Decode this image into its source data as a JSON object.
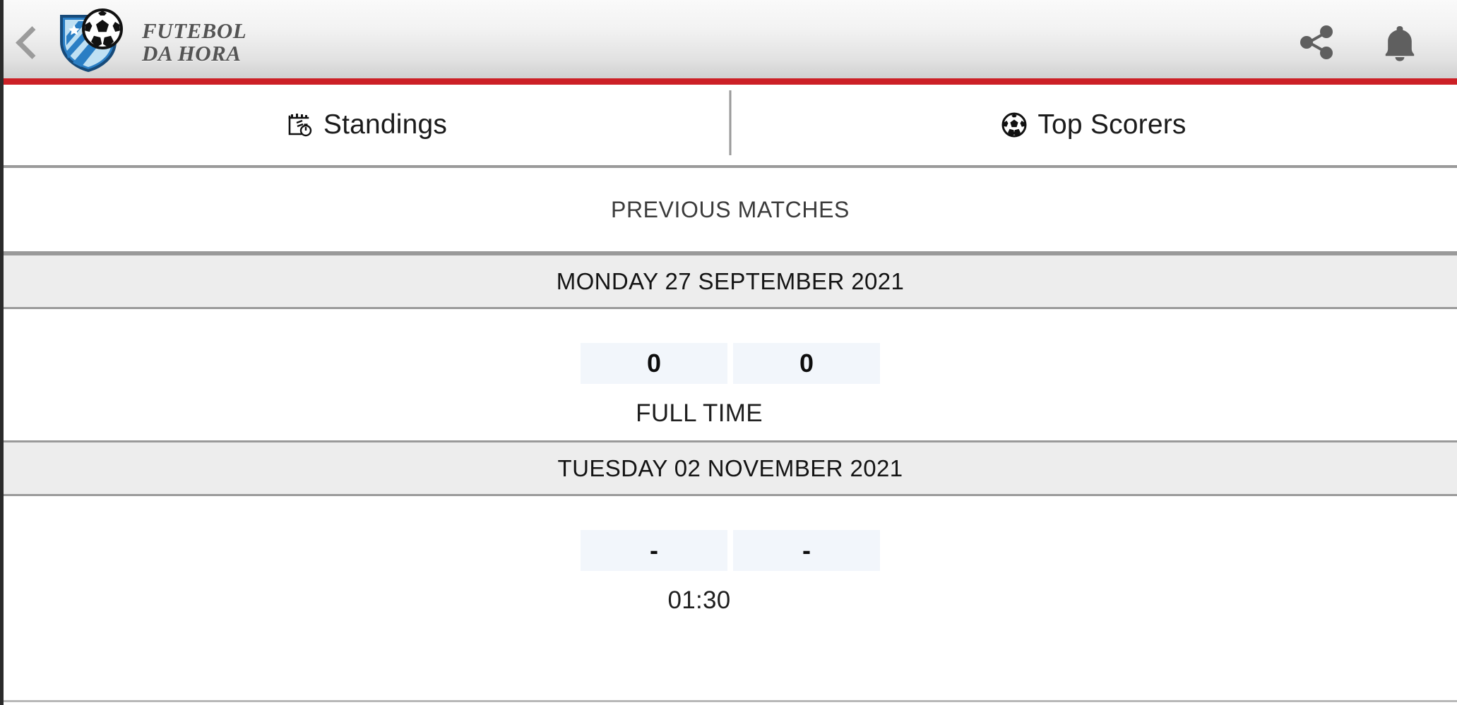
{
  "header": {
    "back_icon": "chevron-left-icon",
    "brand_line1": "FUTEBOL",
    "brand_line2": "DA HORA",
    "logo_icon": "shield-soccer-ball-logo",
    "share_icon": "share-icon",
    "notifications_icon": "bell-icon",
    "accent_color": "#cc2026",
    "gradient_top": "#fafafa",
    "gradient_bottom": "#cbcbcb"
  },
  "tabs": [
    {
      "label": "Standings",
      "icon": "calendar-stopwatch-icon",
      "selected": true
    },
    {
      "label": "Top Scorers",
      "icon": "soccer-ball-icon",
      "selected": false
    }
  ],
  "main": {
    "section_title": "PREVIOUS MATCHES",
    "groups": [
      {
        "date": "MONDAY 27 SEPTEMBER 2021",
        "matches": [
          {
            "home_score": "0",
            "away_score": "0",
            "status": "FULL TIME"
          }
        ]
      },
      {
        "date": "TUESDAY 02 NOVEMBER 2021",
        "matches": [
          {
            "home_score": "-",
            "away_score": "-",
            "status": "01:30"
          }
        ]
      }
    ]
  },
  "colors": {
    "score_box_bg": "#f2f6fb",
    "date_band_bg": "#ededed",
    "divider": "#9a9a9a"
  }
}
